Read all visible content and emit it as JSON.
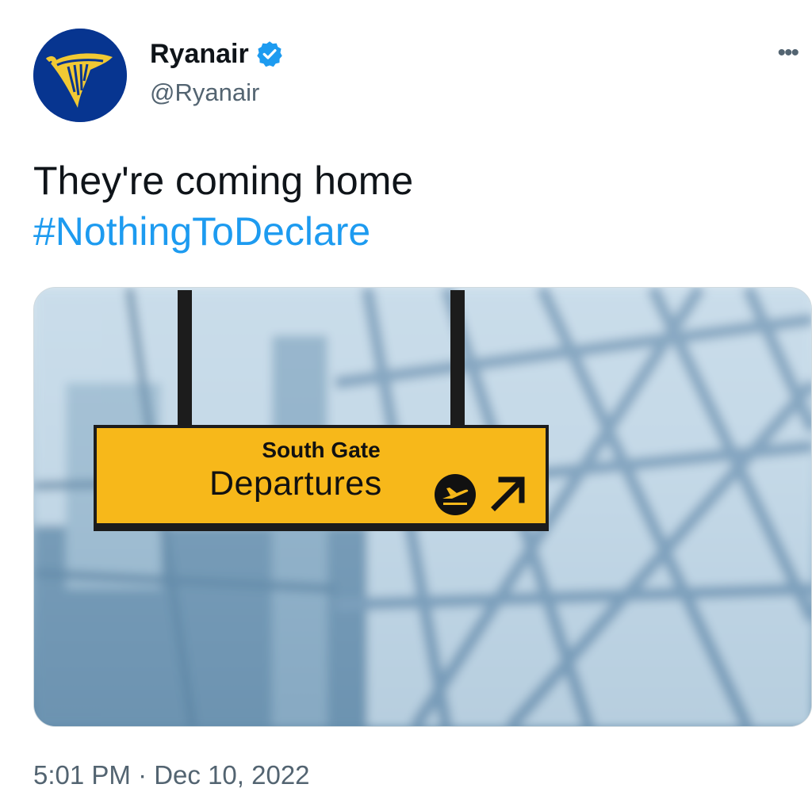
{
  "author": {
    "display_name": "Ryanair",
    "handle": "@Ryanair",
    "avatar_icon": "ryanair-harp-logo",
    "verified_icon": "verified-badge-icon"
  },
  "menu_icon": "more-options-icon",
  "tweet": {
    "text": "They're coming home",
    "hashtag": "#NothingToDeclare"
  },
  "media": {
    "sign_line1": "South Gate",
    "sign_line2": "Departures"
  },
  "meta": {
    "timestamp": "5:01 PM · Dec 10, 2022"
  },
  "colors": {
    "accent": "#1d9bf0",
    "brand": "#073590",
    "sign": "#f7b81a"
  }
}
